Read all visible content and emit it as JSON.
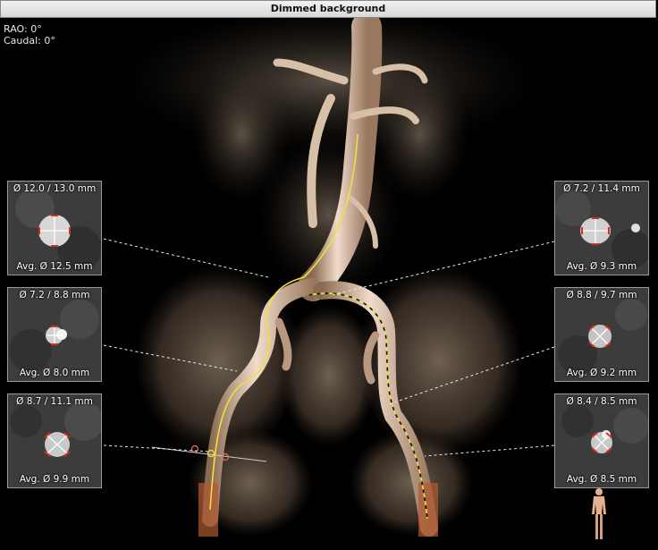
{
  "window": {
    "title": "Dimmed background"
  },
  "orientation": {
    "rao": "RAO: 0°",
    "caudal": "Caudal: 0°"
  },
  "panels": {
    "left": [
      {
        "diameter": "Ø 12.0 / 13.0 mm",
        "average": "Avg. Ø 12.5 mm"
      },
      {
        "diameter": "Ø 7.2 / 8.8 mm",
        "average": "Avg. Ø 8.0 mm"
      },
      {
        "diameter": "Ø 8.7 / 11.1 mm",
        "average": "Avg. Ø 9.9 mm"
      }
    ],
    "right": [
      {
        "diameter": "Ø 7.2 / 11.4 mm",
        "average": "Avg. Ø 9.3 mm"
      },
      {
        "diameter": "Ø 8.8 / 9.7 mm",
        "average": "Avg. Ø 9.2 mm"
      },
      {
        "diameter": "Ø 8.4 / 8.5 mm",
        "average": "Avg. Ø 8.5 mm"
      }
    ]
  },
  "icons": {
    "orientation_figure": "human-body-icon"
  },
  "colors": {
    "centerline": "#f0e040",
    "measure_caliper": "#d03020",
    "leader_line": "#e8e8e8"
  }
}
